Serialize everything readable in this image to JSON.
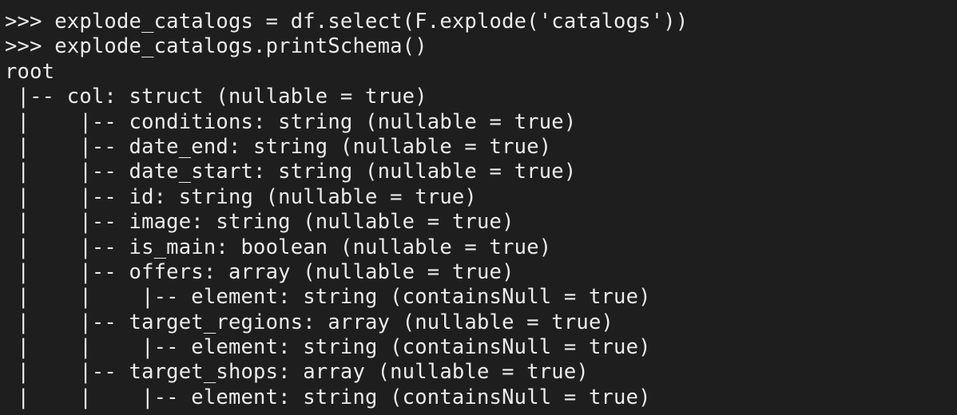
{
  "terminal": {
    "lines": [
      ">>> explode_catalogs = df.select(F.explode('catalogs'))",
      ">>> explode_catalogs.printSchema()",
      "root",
      " |-- col: struct (nullable = true)",
      " |    |-- conditions: string (nullable = true)",
      " |    |-- date_end: string (nullable = true)",
      " |    |-- date_start: string (nullable = true)",
      " |    |-- id: string (nullable = true)",
      " |    |-- image: string (nullable = true)",
      " |    |-- is_main: boolean (nullable = true)",
      " |    |-- offers: array (nullable = true)",
      " |    |    |-- element: string (containsNull = true)",
      " |    |-- target_regions: array (nullable = true)",
      " |    |    |-- element: string (containsNull = true)",
      " |    |-- target_shops: array (nullable = true)",
      " |    |    |-- element: string (containsNull = true)"
    ]
  }
}
